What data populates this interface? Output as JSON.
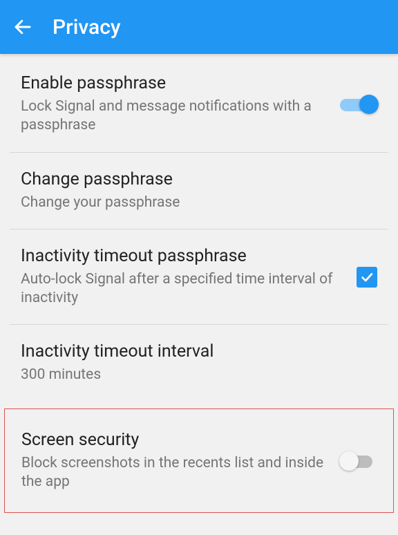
{
  "header": {
    "title": "Privacy"
  },
  "items": [
    {
      "title": "Enable passphrase",
      "subtitle": "Lock Signal and message notifications with a passphrase",
      "control": "switch",
      "state": "on"
    },
    {
      "title": "Change passphrase",
      "subtitle": "Change your passphrase",
      "control": "none"
    },
    {
      "title": "Inactivity timeout passphrase",
      "subtitle": "Auto-lock Signal after a specified time interval of inactivity",
      "control": "checkbox",
      "state": "checked"
    },
    {
      "title": "Inactivity timeout interval",
      "subtitle": "300 minutes",
      "control": "none"
    },
    {
      "title": "Screen security",
      "subtitle": "Block screenshots in the recents list and inside the app",
      "control": "switch",
      "state": "off",
      "highlight": true
    }
  ]
}
